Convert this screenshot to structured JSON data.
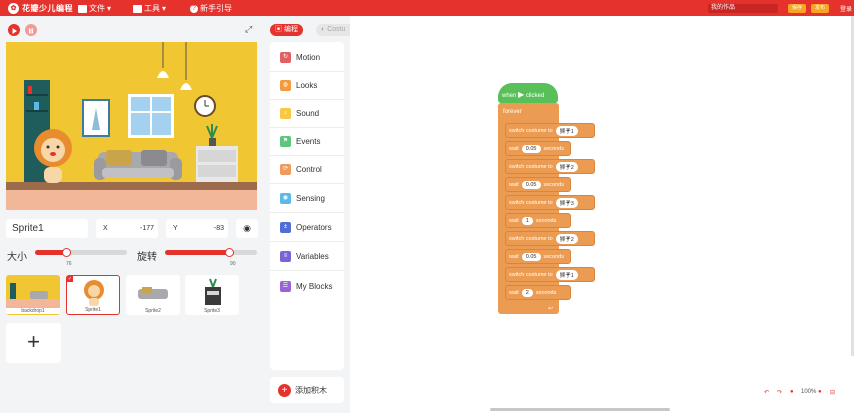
{
  "topbar": {
    "brand": "花瓣少儿编程",
    "menu_file": "文件",
    "menu_tools": "工具",
    "menu_guide": "新手引导",
    "project_name": "我的作品",
    "save_label": "保存",
    "publish_label": "发布",
    "login_label": "登录"
  },
  "stage_panel": {
    "sprite_name": "Sprite1",
    "x_label": "X",
    "x_value": "-177",
    "y_label": "Y",
    "y_value": "-83",
    "size_label": "大小",
    "size_value": "76",
    "size_fraction": 0.76,
    "rotation_label": "旋转",
    "rotation_value": "90",
    "rotation_fraction": 0.5
  },
  "sprites": [
    {
      "name": "backdrop1",
      "selected": false
    },
    {
      "name": "Sprite1",
      "selected": true
    },
    {
      "name": "Sprite2",
      "selected": false
    },
    {
      "name": "Sprite3",
      "selected": false
    }
  ],
  "add_sprite_symbol": "+",
  "tabs": {
    "code": "编程",
    "costumes": "Costu"
  },
  "categories": [
    {
      "label": "Motion",
      "color": "#e26060",
      "icon": "motion-icon"
    },
    {
      "label": "Looks",
      "color": "#f39a3c",
      "icon": "looks-icon"
    },
    {
      "label": "Sound",
      "color": "#f7c843",
      "icon": "sound-icon"
    },
    {
      "label": "Events",
      "color": "#5cc67d",
      "icon": "events-icon"
    },
    {
      "label": "Control",
      "color": "#ef9b5d",
      "icon": "control-icon"
    },
    {
      "label": "Sensing",
      "color": "#5cb8e6",
      "icon": "sensing-icon"
    },
    {
      "label": "Operators",
      "color": "#4f6fd6",
      "icon": "operators-icon"
    },
    {
      "label": "Variables",
      "color": "#7b63d6",
      "icon": "variables-icon"
    },
    {
      "label": "My Blocks",
      "color": "#9a64d4",
      "icon": "myblocks-icon"
    }
  ],
  "add_blocks_label": "添加积木",
  "script": {
    "hat_when": "when",
    "hat_clicked": "clicked",
    "forever": "forever",
    "blocks": [
      {
        "kind": "costume",
        "text": "switch costume to",
        "value": "狮子1"
      },
      {
        "kind": "wait",
        "text": "wait",
        "value": "0.05",
        "unit": "seconds"
      },
      {
        "kind": "costume",
        "text": "switch costume to",
        "value": "狮子2"
      },
      {
        "kind": "wait",
        "text": "wait",
        "value": "0.05",
        "unit": "seconds"
      },
      {
        "kind": "costume",
        "text": "switch costume to",
        "value": "狮子3"
      },
      {
        "kind": "wait",
        "text": "wait",
        "value": "1",
        "unit": "seconds"
      },
      {
        "kind": "costume",
        "text": "switch costume to",
        "value": "狮子2"
      },
      {
        "kind": "wait",
        "text": "wait",
        "value": "0.05",
        "unit": "seconds"
      },
      {
        "kind": "costume",
        "text": "switch costume to",
        "value": "狮子1"
      },
      {
        "kind": "wait",
        "text": "wait",
        "value": "2",
        "unit": "seconds"
      }
    ]
  },
  "zoom": "100%",
  "colors": {
    "accent": "#e5322d",
    "events": "#59c059",
    "control": "#ec9b52"
  }
}
